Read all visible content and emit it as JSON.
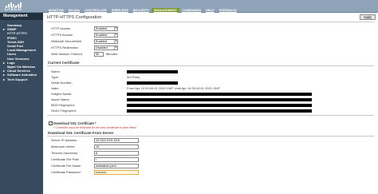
{
  "brand": {
    "name": "CISCO"
  },
  "nav": {
    "items": [
      {
        "label": "MONITOR"
      },
      {
        "label": "WLANs"
      },
      {
        "label": "CONTROLLER"
      },
      {
        "label": "WIRELESS"
      },
      {
        "label": "SECURITY"
      },
      {
        "label": "MANAGEMENT",
        "active": true
      },
      {
        "label": "COMMANDS"
      },
      {
        "label": "HELP"
      },
      {
        "label": "FEEDBACK"
      }
    ]
  },
  "sidebar": {
    "title": "Management",
    "items": [
      {
        "label": "Summary"
      },
      {
        "label": "SNMP",
        "caret": "▸"
      },
      {
        "label": "HTTP-HTTPS",
        "current": true
      },
      {
        "label": "IPSEC"
      },
      {
        "label": "Telnet-SSH"
      },
      {
        "label": "Serial Port"
      },
      {
        "label": "Local Management"
      },
      {
        "label": "Users"
      },
      {
        "label": "User Sessions"
      },
      {
        "label": "Logs",
        "caret": "▸"
      },
      {
        "label": "Mgmt Via Wireless"
      },
      {
        "label": "Cloud Services",
        "caret": "▸"
      },
      {
        "label": "Software Activation",
        "caret": "▸"
      },
      {
        "label": "Tech Support",
        "caret": "▸"
      }
    ]
  },
  "page": {
    "title": "HTTP-HTTPS Configuration",
    "apply_label": "Apply"
  },
  "config": {
    "http_access": {
      "label": "HTTP Access",
      "value": "Enabled"
    },
    "https_access": {
      "label": "HTTPS Access",
      "value": "Enabled"
    },
    "webauth_secure": {
      "label": "WebAuth SecureWeb",
      "value": "Enabled"
    },
    "https_redirection": {
      "label": "HTTPS Redirection",
      "value": "Disabled"
    },
    "session_timeout": {
      "label": "Web Session Timeout",
      "value": "30",
      "unit": "Minutes"
    }
  },
  "cert": {
    "section_title": "Current Certificate",
    "rows": [
      {
        "label": "Name:",
        "value": ""
      },
      {
        "label": "Type:",
        "value": "3rd Party"
      },
      {
        "label": "Serial Number:",
        "value": ""
      },
      {
        "label": "Valid:",
        "value": "From Apr 14 00:00:01 2020 GMT Until Apr 14 00:00:01 2021 GMT"
      },
      {
        "label": "Subject Name:",
        "value": ""
      },
      {
        "label": "Issuer Name:",
        "value": ""
      },
      {
        "label": "MD5 Fingerprint:",
        "value": ""
      },
      {
        "label": "SHA1 Fingerprint:",
        "value": ""
      }
    ]
  },
  "download": {
    "checkbox_label": "Download SSL Certificate *",
    "checked": true,
    "note": "* Controller must be rebooted for the new certificate to take effect.",
    "section_title": "Download SSL Certificate From Server",
    "fields": {
      "server_ip": {
        "label": "Server IP Address",
        "value": "10.XXX.XXX.XXX"
      },
      "max_retries": {
        "label": "Maximum retries",
        "value": "10"
      },
      "timeout": {
        "label": "Timeout (seconds)",
        "value": "6"
      },
      "file_path": {
        "label": "Certificate File Path",
        "value": "/"
      },
      "file_name": {
        "label": "Certificate File Name",
        "value": "webadmin.pem"
      },
      "password": {
        "label": "Certificate Password",
        "value": "••••••••••"
      }
    }
  }
}
